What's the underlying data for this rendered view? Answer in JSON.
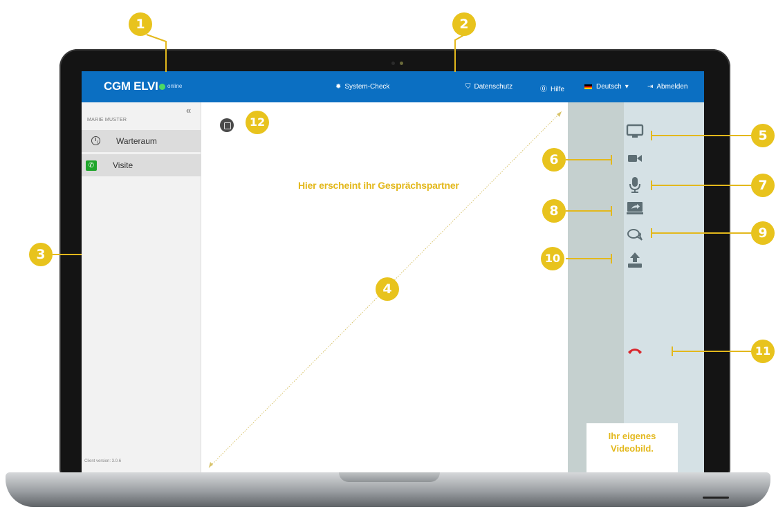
{
  "app": {
    "brand": "CGM ELVI",
    "status": "online",
    "nav": {
      "system_check": "System-Check",
      "privacy": "Datenschutz",
      "help": "Hilfe",
      "language": "Deutsch",
      "logout": "Abmelden"
    }
  },
  "sidebar": {
    "collapse_glyph": "«",
    "user_name": "MARIE MUSTER",
    "items": [
      {
        "label": "Warteraum",
        "icon": "clock-icon"
      },
      {
        "label": "Visite",
        "icon": "phone-icon"
      }
    ],
    "client_version": "Client version: 3.0.6"
  },
  "main": {
    "partner_placeholder": "Hier erscheint ihr Gesprächspartner",
    "own_video_line1": "Ihr eigenes",
    "own_video_line2": "Videobild."
  },
  "controls": [
    {
      "name": "monitor-icon",
      "glyph": "▭"
    },
    {
      "name": "camera-icon",
      "glyph": "■"
    },
    {
      "name": "microphone-icon",
      "glyph": "⎍"
    },
    {
      "name": "screen-share-icon",
      "glyph": "⇗"
    },
    {
      "name": "chat-icon",
      "glyph": "🗨"
    },
    {
      "name": "upload-icon",
      "glyph": "⇪"
    },
    {
      "name": "hang-up-icon",
      "glyph": "☎"
    }
  ],
  "callouts": [
    "1",
    "2",
    "3",
    "4",
    "5",
    "6",
    "7",
    "8",
    "9",
    "10",
    "11",
    "12"
  ],
  "colors": {
    "topbar": "#0b6fc2",
    "callout": "#e8c31d",
    "hangup": "#d9262c",
    "status_online": "#4cd964"
  }
}
